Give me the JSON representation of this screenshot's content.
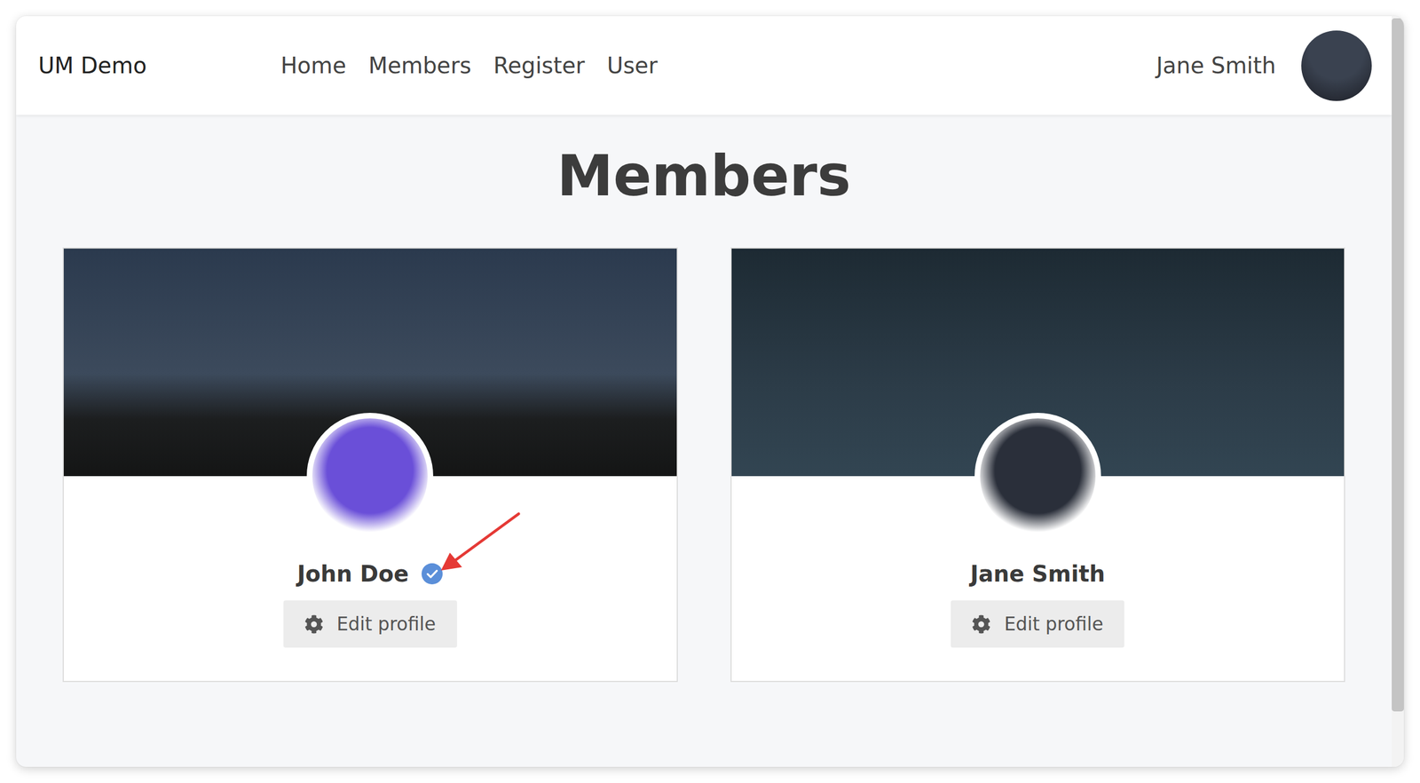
{
  "navbar": {
    "brand": "UM Demo",
    "links": [
      "Home",
      "Members",
      "Register",
      "User"
    ],
    "user": {
      "name": "Jane Smith"
    }
  },
  "page": {
    "title": "Members"
  },
  "members": [
    {
      "name": "John Doe",
      "verified": true,
      "annotated": true,
      "color": "#6a4fd8",
      "button": "Edit profile"
    },
    {
      "name": "Jane Smith",
      "verified": false,
      "annotated": false,
      "color": "#2a2f3a",
      "button": "Edit profile"
    }
  ]
}
